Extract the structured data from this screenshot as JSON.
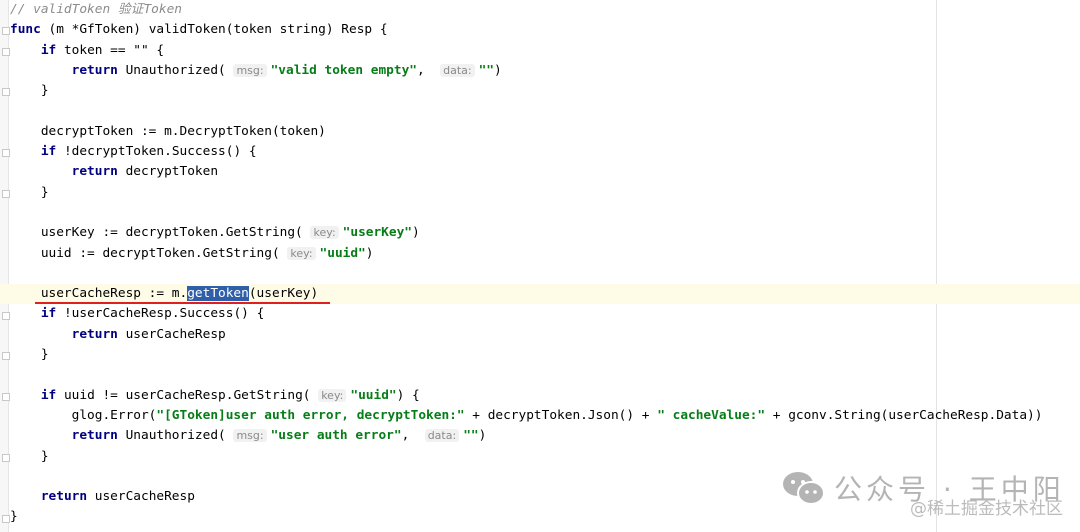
{
  "editor": {
    "current_line_index": 14,
    "selected_text": "getToken",
    "lines": [
      [
        {
          "t": "// validToken 验证Token",
          "c": "cm"
        }
      ],
      [
        {
          "t": "func",
          "c": "kw"
        },
        {
          "t": " (m *GfToken) validToken(token string) Resp {"
        }
      ],
      [
        {
          "t": "    "
        },
        {
          "t": "if",
          "c": "kw"
        },
        {
          "t": " token == \"\" {"
        }
      ],
      [
        {
          "t": "        "
        },
        {
          "t": "return",
          "c": "kw"
        },
        {
          "t": " Unauthorized( "
        },
        {
          "t": "msg:",
          "c": "hint"
        },
        {
          "t": "\"valid token empty\"",
          "c": "str"
        },
        {
          "t": ",  "
        },
        {
          "t": "data:",
          "c": "hint"
        },
        {
          "t": "\"\"",
          "c": "str"
        },
        {
          "t": ")"
        }
      ],
      [
        {
          "t": "    }"
        }
      ],
      [
        {
          "t": ""
        }
      ],
      [
        {
          "t": "    decryptToken := m.DecryptToken(token)"
        }
      ],
      [
        {
          "t": "    "
        },
        {
          "t": "if",
          "c": "kw"
        },
        {
          "t": " !decryptToken.Success() {"
        }
      ],
      [
        {
          "t": "        "
        },
        {
          "t": "return",
          "c": "kw"
        },
        {
          "t": " decryptToken"
        }
      ],
      [
        {
          "t": "    }"
        }
      ],
      [
        {
          "t": ""
        }
      ],
      [
        {
          "t": "    userKey := decryptToken.GetString( "
        },
        {
          "t": "key:",
          "c": "hint"
        },
        {
          "t": "\"userKey\"",
          "c": "str"
        },
        {
          "t": ")"
        }
      ],
      [
        {
          "t": "    uuid := decryptToken.GetString( "
        },
        {
          "t": "key:",
          "c": "hint"
        },
        {
          "t": "\"uuid\"",
          "c": "str"
        },
        {
          "t": ")"
        }
      ],
      [
        {
          "t": ""
        }
      ],
      [
        {
          "t": "    userCacheResp := m."
        },
        {
          "t": "getToken",
          "c": "sel"
        },
        {
          "t": "(userKey)"
        }
      ],
      [
        {
          "t": "    "
        },
        {
          "t": "if",
          "c": "kw"
        },
        {
          "t": " !userCacheResp.Success() {"
        }
      ],
      [
        {
          "t": "        "
        },
        {
          "t": "return",
          "c": "kw"
        },
        {
          "t": " userCacheResp"
        }
      ],
      [
        {
          "t": "    }"
        }
      ],
      [
        {
          "t": ""
        }
      ],
      [
        {
          "t": "    "
        },
        {
          "t": "if",
          "c": "kw"
        },
        {
          "t": " uuid != userCacheResp.GetString( "
        },
        {
          "t": "key:",
          "c": "hint"
        },
        {
          "t": "\"uuid\"",
          "c": "str"
        },
        {
          "t": ") {"
        }
      ],
      [
        {
          "t": "        glog.Error("
        },
        {
          "t": "\"[GToken]user auth error, decryptToken:\"",
          "c": "str"
        },
        {
          "t": " + decryptToken.Json() + "
        },
        {
          "t": "\" cacheValue:\"",
          "c": "str"
        },
        {
          "t": " + gconv.String(userCacheResp.Data))"
        }
      ],
      [
        {
          "t": "        "
        },
        {
          "t": "return",
          "c": "kw"
        },
        {
          "t": " Unauthorized( "
        },
        {
          "t": "msg:",
          "c": "hint"
        },
        {
          "t": "\"user auth error\"",
          "c": "str"
        },
        {
          "t": ",  "
        },
        {
          "t": "data:",
          "c": "hint"
        },
        {
          "t": "\"\"",
          "c": "str"
        },
        {
          "t": ")"
        }
      ],
      [
        {
          "t": "    }"
        }
      ],
      [
        {
          "t": ""
        }
      ],
      [
        {
          "t": "    "
        },
        {
          "t": "return",
          "c": "kw"
        },
        {
          "t": " userCacheResp"
        }
      ],
      [
        {
          "t": "}"
        }
      ]
    ],
    "fold_marker_lines": [
      1,
      2,
      4,
      7,
      9,
      15,
      17,
      19,
      22,
      25
    ]
  },
  "watermark": {
    "title": "公众号 · 王中阳",
    "subtitle": "@稀土掘金技术社区",
    "icon": "wechat-icon"
  },
  "colors": {
    "keyword": "#000080",
    "string": "#067d17",
    "comment": "#8c8c8c",
    "selection": "#2f5fa8",
    "current_line": "#fefbe6",
    "underline": "#e02020"
  }
}
